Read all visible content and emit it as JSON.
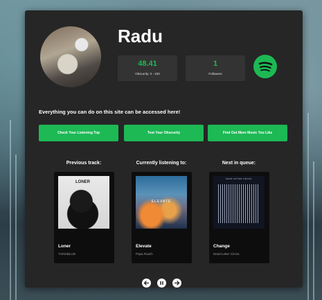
{
  "profile": {
    "username": "Radu",
    "obscurity_value": "48.41",
    "obscurity_label": "Obscurity: 0 - 100",
    "followers_value": "1",
    "followers_label": "Followers"
  },
  "intro_text": "Everything you can do on this site can be accessed here!",
  "actions": [
    {
      "label": "Check Your Listening Top"
    },
    {
      "label": "Test Your Obscurity"
    },
    {
      "label": "Find Out More Music You Like"
    }
  ],
  "tracks": [
    {
      "heading": "Previous track:",
      "title": "Loner",
      "artist": "YUNGBLUD",
      "cover_text": "LONER"
    },
    {
      "heading": "Currently listening to:",
      "title": "Elevate",
      "artist": "Papa Roach",
      "cover_text": "ELEVATE"
    },
    {
      "heading": "Next in queue:",
      "title": "Change",
      "artist": "Dead Letter Circus",
      "cover_text": "DEAD LETTER CIRCUS"
    }
  ],
  "controls": {
    "previous_icon": "arrow-left-icon",
    "pause_icon": "pause-icon",
    "next_icon": "arrow-right-icon"
  },
  "colors": {
    "accent": "#1db954",
    "card": "#262626",
    "stat_box": "#333333",
    "track_card": "#0d0d0d"
  },
  "icons": {
    "spotify": "spotify-logo-icon"
  }
}
